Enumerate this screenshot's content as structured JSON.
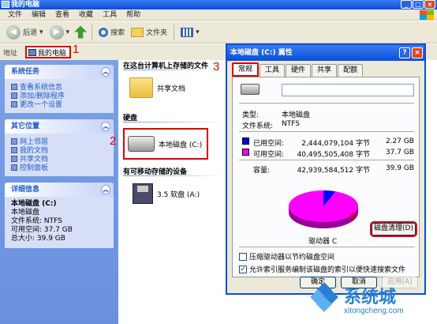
{
  "window": {
    "title": "我的电脑"
  },
  "menu": [
    "文件",
    "编辑",
    "查看",
    "收藏",
    "工具",
    "帮助"
  ],
  "toolbar": {
    "back": "后退",
    "search": "搜索",
    "folders": "文件夹"
  },
  "address": {
    "label": "地址",
    "value": "我的电脑"
  },
  "annotations": [
    "1",
    "2",
    "3",
    "4"
  ],
  "left": {
    "system_tasks": {
      "title": "系统任务",
      "items": [
        "查看系统信息",
        "添加/删除程序",
        "更改一个设置"
      ]
    },
    "other_places": {
      "title": "其它位置",
      "items": [
        "网上邻居",
        "我的文档",
        "共享文档",
        "控制面板"
      ]
    },
    "details": {
      "title": "详细信息",
      "name": "本地磁盘 (C:)",
      "type": "本地磁盘",
      "fs": "文件系统: NTFS",
      "free": "可用空间: 37.7 GB",
      "total": "总大小: 39.9 GB"
    }
  },
  "main": {
    "group_files": "在这台计算机上存储的文件",
    "shared_docs": "共享文档",
    "group_hdd": "硬盘",
    "local_disk": "本地磁盘 (C:)",
    "group_removable": "有可移动存储的设备",
    "floppy": "3.5 软盘 (A:)"
  },
  "dialog": {
    "title": "本地磁盘 (C:) 属性",
    "tabs": [
      "常规",
      "工具",
      "硬件",
      "共享",
      "配额"
    ],
    "type_label": "类型:",
    "type_value": "本地磁盘",
    "fs_label": "文件系统:",
    "fs_value": "NTFS",
    "used_label": "已用空间:",
    "used_bytes": "2,444,079,104 字节",
    "used_gb": "2.27 GB",
    "free_label": "可用空间:",
    "free_bytes": "40,495,505,408 字节",
    "free_gb": "37.7 GB",
    "cap_label": "容量:",
    "cap_bytes": "42,939,584,512 字节",
    "cap_gb": "39.9 GB",
    "drive_label": "驱动器 C",
    "cleanup": "磁盘清理(D)",
    "compress": "压缩驱动器以节约磁盘空间",
    "index": "允许索引服务编制该磁盘的索引以便快速搜索文件",
    "ok": "确定",
    "cancel": "取消",
    "apply": "应用(A)",
    "used_fraction": 0.057,
    "colors": {
      "used": "#0000ff",
      "free": "#ff00ff"
    }
  },
  "watermark": {
    "text": "系统城",
    "url": "xitongcheng.com"
  }
}
